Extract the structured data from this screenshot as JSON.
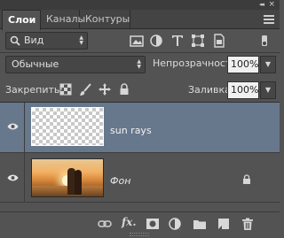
{
  "window": {
    "collapse_glyph": "◂◂",
    "close_glyph": "×"
  },
  "tabs": [
    {
      "label": "Слои"
    },
    {
      "label": "Каналы"
    },
    {
      "label": "Контуры"
    }
  ],
  "filter": {
    "kind_label": "Вид"
  },
  "blend": {
    "mode": "Обычные",
    "opacity_label": "Непрозрачность:",
    "opacity_value": "100%"
  },
  "lock": {
    "label": "Закрепить:",
    "fill_label": "Заливка:",
    "fill_value": "100%"
  },
  "layers": [
    {
      "name": "sun rays",
      "visible": true,
      "selected": true
    },
    {
      "name": "Фон",
      "visible": true,
      "selected": false,
      "locked": true
    }
  ],
  "colors": {
    "selected_row": "#67778c",
    "panel": "#535353"
  },
  "footer_icons": [
    "link-icon",
    "fx-icon",
    "mask-icon",
    "adjustment-icon",
    "folder-icon",
    "new-layer-icon",
    "trash-icon"
  ]
}
